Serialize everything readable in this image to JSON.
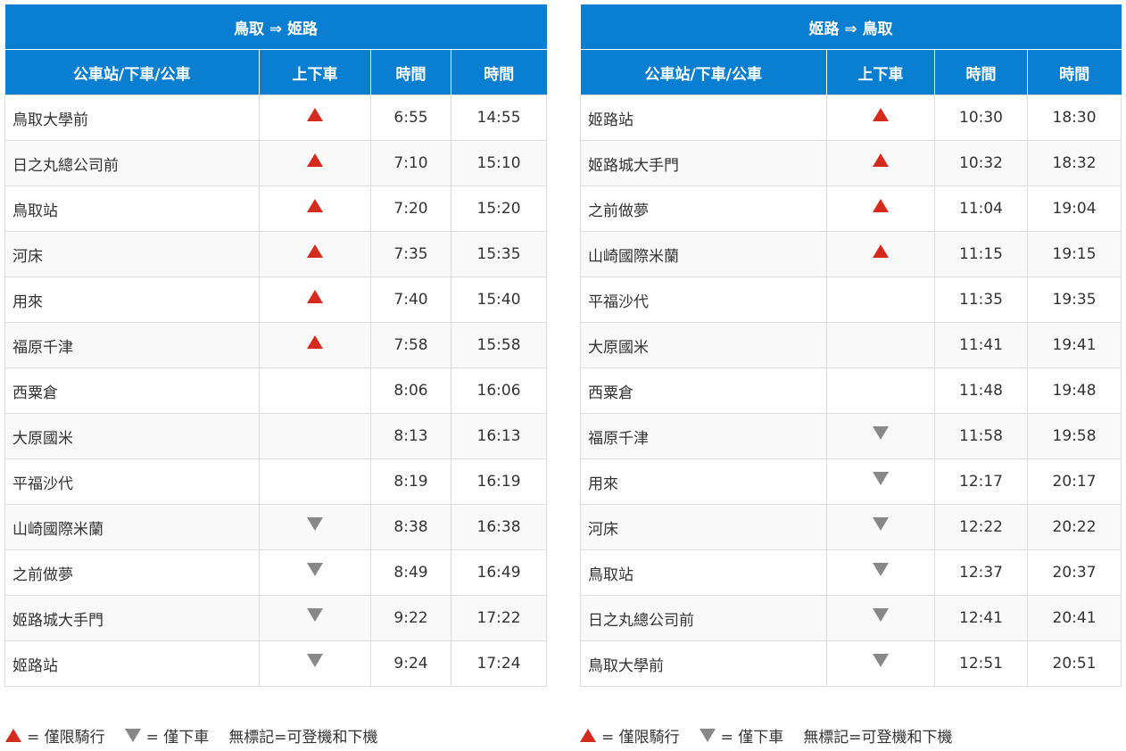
{
  "colors": {
    "header": "#0a7fd1",
    "up_mark": "#d52b1e",
    "down_mark": "#888888"
  },
  "icons": {
    "up": "triangle-up-icon",
    "down": "triangle-down-icon"
  },
  "columns": [
    "公車站/下車/公車",
    "上下車",
    "時間",
    "時間"
  ],
  "tables": [
    {
      "title": "鳥取 ⇒ 姬路",
      "rows": [
        {
          "stop": "鳥取大學前",
          "mark": "up",
          "t1": "6:55",
          "t2": "14:55"
        },
        {
          "stop": "日之丸總公司前",
          "mark": "up",
          "t1": "7:10",
          "t2": "15:10"
        },
        {
          "stop": "鳥取站",
          "mark": "up",
          "t1": "7:20",
          "t2": "15:20"
        },
        {
          "stop": "河床",
          "mark": "up",
          "t1": "7:35",
          "t2": "15:35"
        },
        {
          "stop": "用來",
          "mark": "up",
          "t1": "7:40",
          "t2": "15:40"
        },
        {
          "stop": "福原千津",
          "mark": "up",
          "t1": "7:58",
          "t2": "15:58"
        },
        {
          "stop": "西粟倉",
          "mark": "",
          "t1": "8:06",
          "t2": "16:06"
        },
        {
          "stop": "大原國米",
          "mark": "",
          "t1": "8:13",
          "t2": "16:13"
        },
        {
          "stop": "平福沙代",
          "mark": "",
          "t1": "8:19",
          "t2": "16:19"
        },
        {
          "stop": "山崎國際米蘭",
          "mark": "down",
          "t1": "8:38",
          "t2": "16:38"
        },
        {
          "stop": "之前做夢",
          "mark": "down",
          "t1": "8:49",
          "t2": "16:49"
        },
        {
          "stop": "姬路城大手門",
          "mark": "down",
          "t1": "9:22",
          "t2": "17:22"
        },
        {
          "stop": "姬路站",
          "mark": "down",
          "t1": "9:24",
          "t2": "17:24"
        }
      ]
    },
    {
      "title": "姬路 ⇒ 鳥取",
      "rows": [
        {
          "stop": "姬路站",
          "mark": "up",
          "t1": "10:30",
          "t2": "18:30"
        },
        {
          "stop": "姬路城大手門",
          "mark": "up",
          "t1": "10:32",
          "t2": "18:32"
        },
        {
          "stop": "之前做夢",
          "mark": "up",
          "t1": "11:04",
          "t2": "19:04"
        },
        {
          "stop": "山崎國際米蘭",
          "mark": "up",
          "t1": "11:15",
          "t2": "19:15"
        },
        {
          "stop": "平福沙代",
          "mark": "",
          "t1": "11:35",
          "t2": "19:35"
        },
        {
          "stop": "大原國米",
          "mark": "",
          "t1": "11:41",
          "t2": "19:41"
        },
        {
          "stop": "西粟倉",
          "mark": "",
          "t1": "11:48",
          "t2": "19:48"
        },
        {
          "stop": "福原千津",
          "mark": "down",
          "t1": "11:58",
          "t2": "19:58"
        },
        {
          "stop": "用來",
          "mark": "down",
          "t1": "12:17",
          "t2": "20:17"
        },
        {
          "stop": "河床",
          "mark": "down",
          "t1": "12:22",
          "t2": "20:22"
        },
        {
          "stop": "鳥取站",
          "mark": "down",
          "t1": "12:37",
          "t2": "20:37"
        },
        {
          "stop": "日之丸總公司前",
          "mark": "down",
          "t1": "12:41",
          "t2": "20:41"
        },
        {
          "stop": "鳥取大學前",
          "mark": "down",
          "t1": "12:51",
          "t2": "20:51"
        }
      ]
    }
  ],
  "legend": {
    "up_text": "= 僅限騎行",
    "down_text": "= 僅下車",
    "none_text": "無標記=可登機和下機"
  }
}
